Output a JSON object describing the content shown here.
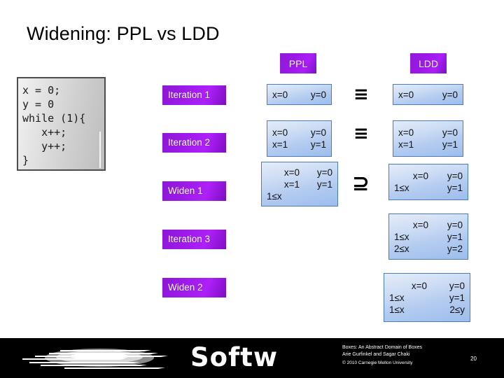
{
  "slide": {
    "title": "Widening: PPL vs LDD",
    "page_number": "20"
  },
  "code": {
    "lines": [
      "x = 0;",
      "y = 0",
      "while (1){",
      "   x++;",
      "   y++;",
      "}"
    ]
  },
  "columns": {
    "ppl_header": "PPL",
    "ldd_header": "LDD"
  },
  "steps": [
    {
      "label": "Iteration 1"
    },
    {
      "label": "Iteration 2"
    },
    {
      "label": "Widen 1"
    },
    {
      "label": "Iteration 3"
    },
    {
      "label": "Widen 2"
    }
  ],
  "ppl_boxes": [
    {
      "rows": [
        {
          "left": "x=0",
          "right": "y=0"
        }
      ]
    },
    {
      "rows": [
        {
          "left": "x=0",
          "right": "y=0"
        },
        {
          "left": "x=1",
          "right": "y=1"
        }
      ]
    },
    {
      "rows": [
        {
          "left": "x=0",
          "right": "y=0"
        },
        {
          "left": "x=1",
          "right": "y=1"
        },
        {
          "left": "1≤x",
          "right": ""
        }
      ]
    }
  ],
  "ldd_boxes": [
    {
      "rows": [
        {
          "left": "x=0",
          "right": "y=0"
        }
      ]
    },
    {
      "rows": [
        {
          "left": "x=0",
          "right": "y=0"
        },
        {
          "left": "x=1",
          "right": "y=1"
        }
      ]
    },
    {
      "rows": [
        {
          "left": "x=0",
          "right": "y=0"
        },
        {
          "left": "1≤x",
          "right": "y=1"
        }
      ]
    },
    {
      "rows": [
        {
          "left": "x=0",
          "right": "y=0"
        },
        {
          "left": "1≤x",
          "right": "y=1"
        },
        {
          "left": "2≤x",
          "right": "y=2"
        }
      ]
    },
    {
      "rows": [
        {
          "left": "x=0",
          "right": "y=0"
        },
        {
          "left": "1≤x",
          "right": "y=1"
        },
        {
          "left": "1≤x",
          "right": "2≤y"
        }
      ]
    }
  ],
  "relations": [
    {
      "symbol": "≡",
      "name": "equivalent"
    },
    {
      "symbol": "≡",
      "name": "equivalent"
    },
    {
      "symbol": "⊇",
      "name": "superset-or-equal"
    }
  ],
  "footer": {
    "logo_text": "Softw",
    "credit_line1": "Boxes: An Abstract Domain of Boxes",
    "credit_line2": "Arie Gurfinkel and Sagar Chaki",
    "credit_line3": "© 2010 Carnegie Mellon University"
  },
  "colors": {
    "purple": "#9b19e8",
    "blue_box_border": "#4a7ebb",
    "blue_box_fill": "#b3cbf0",
    "footer_bg": "#000000"
  }
}
